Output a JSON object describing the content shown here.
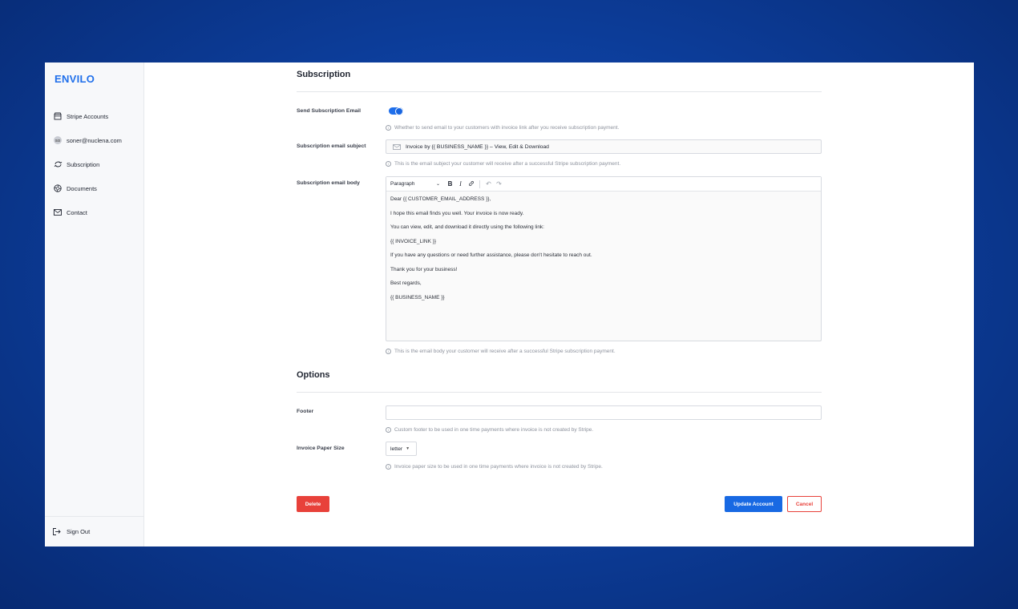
{
  "sidebar": {
    "brand": "ENVILO",
    "items": [
      {
        "label": "Stripe Accounts",
        "icon": "store-icon"
      },
      {
        "label": "soner@nuclena.com",
        "icon": "avatar",
        "avatar_initials": "SO"
      },
      {
        "label": "Subscription",
        "icon": "refresh-icon"
      },
      {
        "label": "Documents",
        "icon": "aperture-icon"
      },
      {
        "label": "Contact",
        "icon": "mail-icon"
      }
    ],
    "sign_out": "Sign Out"
  },
  "subscription": {
    "title": "Subscription",
    "send_email_label": "Send Subscription Email",
    "send_email_enabled": true,
    "send_email_hint": "Whether to send email to your customers with invoice link after you receive subscription payment.",
    "subject_label": "Subscription email subject",
    "subject_value": "Invoice by {{ BUSINESS_NAME }} – View, Edit & Download",
    "subject_hint": "This is the email subject your customer will receive after a successful Stripe subscription payment.",
    "body_label": "Subscription email body",
    "body_hint": "This is the email body your customer will receive after a successful Stripe subscription payment.",
    "editor": {
      "format": "Paragraph",
      "bold": "B",
      "italic": "I",
      "link": "🔗",
      "undo": "↶",
      "redo": "↷",
      "lines": [
        "Dear {{ CUSTOMER_EMAIL_ADDRESS }},",
        "I hope this email finds you well. Your invoice is now ready.",
        "You can view, edit, and download it directly using the following link:",
        "{{ INVOICE_LINK }}",
        "If you have any questions or need further assistance, please don't hesitate to reach out.",
        "Thank you for your business!",
        "Best regards,",
        "{{ BUSINESS_NAME }}"
      ]
    }
  },
  "options": {
    "title": "Options",
    "footer_label": "Footer",
    "footer_value": "",
    "footer_hint": "Custom footer to be used in one time payments where invoice is not created by Stripe.",
    "paper_label": "Invoice Paper Size",
    "paper_value": "letter",
    "paper_hint": "Invoice paper size to be used in one time payments where invoice is not created by Stripe."
  },
  "actions": {
    "delete": "Delete",
    "update": "Update Account",
    "cancel": "Cancel"
  },
  "colors": {
    "accent": "#1f6feb",
    "danger": "#e8413a"
  }
}
